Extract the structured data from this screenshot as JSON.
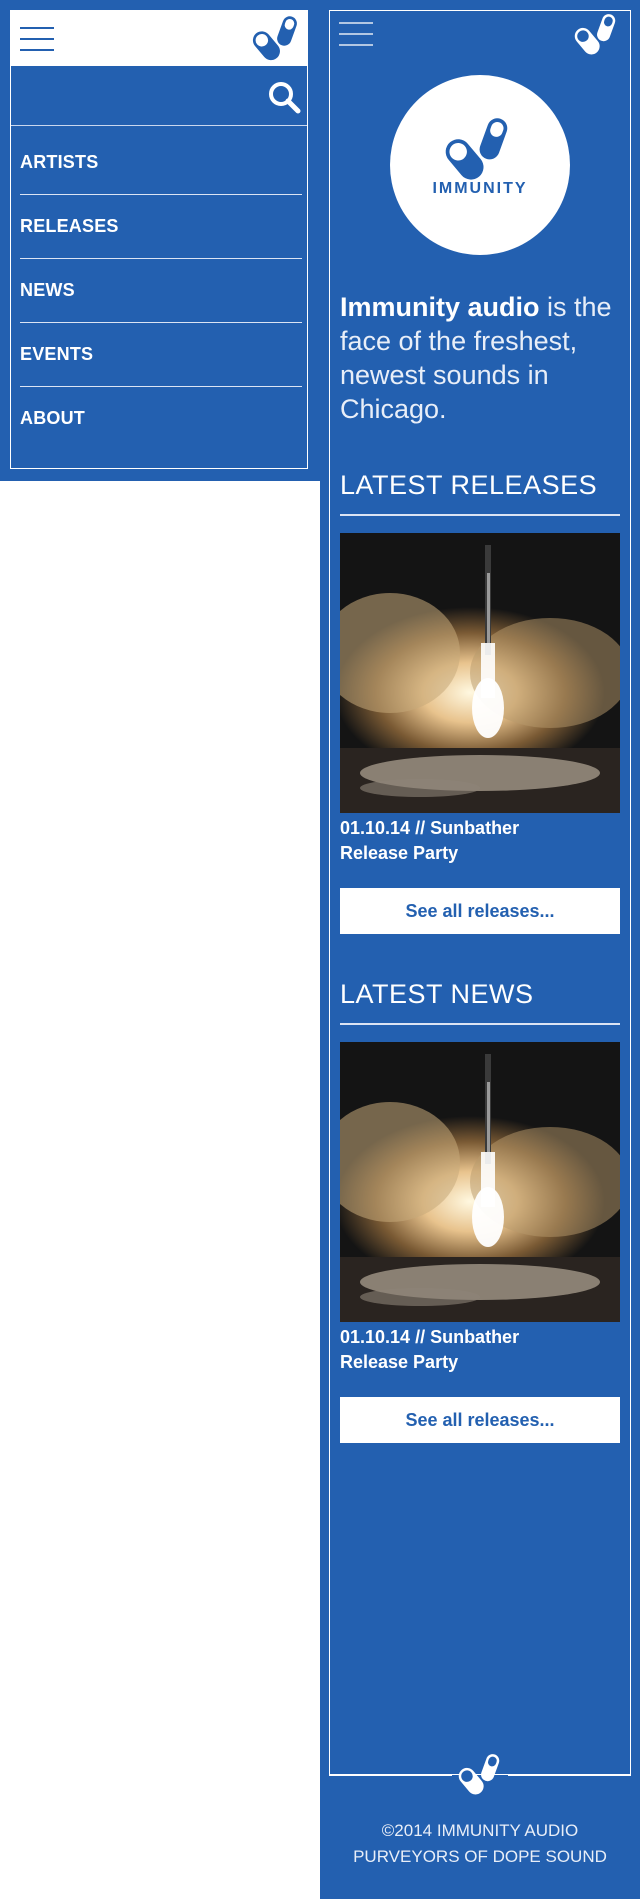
{
  "colors": {
    "brand_blue": "#2360b0",
    "white": "#ffffff"
  },
  "menu": {
    "hamburger_icon": "hamburger-icon",
    "logo_icon": "pills-logo-icon",
    "search_icon": "search-icon",
    "items": [
      {
        "label": "ARTISTS"
      },
      {
        "label": "RELEASES"
      },
      {
        "label": "NEWS"
      },
      {
        "label": "EVENTS"
      },
      {
        "label": "ABOUT"
      }
    ]
  },
  "header": {
    "logo_text": "IMMUNITY"
  },
  "intro": {
    "brand": "Immunity audio",
    "rest": " is the face of the freshest, newest sounds in Chicago."
  },
  "releases": {
    "title": "LATEST RELEASES",
    "item": {
      "image": "rocket-launch-image",
      "caption": "01.10.14 // Sunbather Release Party"
    },
    "see_all": "See all releases..."
  },
  "news": {
    "title": "LATEST NEWS",
    "item": {
      "image": "rocket-launch-image",
      "caption": "01.10.14 // Sunbather Release Party"
    },
    "see_all": "See all releases..."
  },
  "footer": {
    "line1": "©2014 IMMUNITY AUDIO",
    "line2": "PURVEYORS OF DOPE SOUND"
  }
}
